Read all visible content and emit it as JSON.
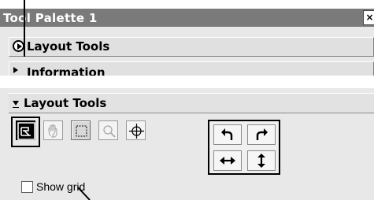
{
  "palette": {
    "title": "Tool Palette 1",
    "close_icon": "close-icon"
  },
  "sections": {
    "layout_tools_collapsed": "Layout Tools",
    "information": "Information"
  },
  "layout_panel": {
    "header": "Layout Tools",
    "tools": [
      {
        "name": "layout-mode-tool",
        "icon": "layout-icon",
        "selected": true
      },
      {
        "name": "hand-tool",
        "icon": "hand-icon",
        "enabled": false
      },
      {
        "name": "selection-tool",
        "icon": "dotted-rectangle-icon",
        "enabled": true
      },
      {
        "name": "zoom-tool",
        "icon": "magnifier-icon",
        "enabled": false
      },
      {
        "name": "target-tool",
        "icon": "crosshair-icon",
        "enabled": true
      }
    ],
    "arrow_buttons": [
      {
        "name": "rotate-left-button",
        "icon": "rotate-left-arrow-icon"
      },
      {
        "name": "rotate-right-button",
        "icon": "rotate-right-arrow-icon"
      },
      {
        "name": "flip-horizontal-button",
        "icon": "horizontal-double-arrow-icon"
      },
      {
        "name": "flip-vertical-button",
        "icon": "vertical-double-arrow-icon"
      }
    ],
    "show_grid_label": "Show grid",
    "show_grid_checked": false
  }
}
